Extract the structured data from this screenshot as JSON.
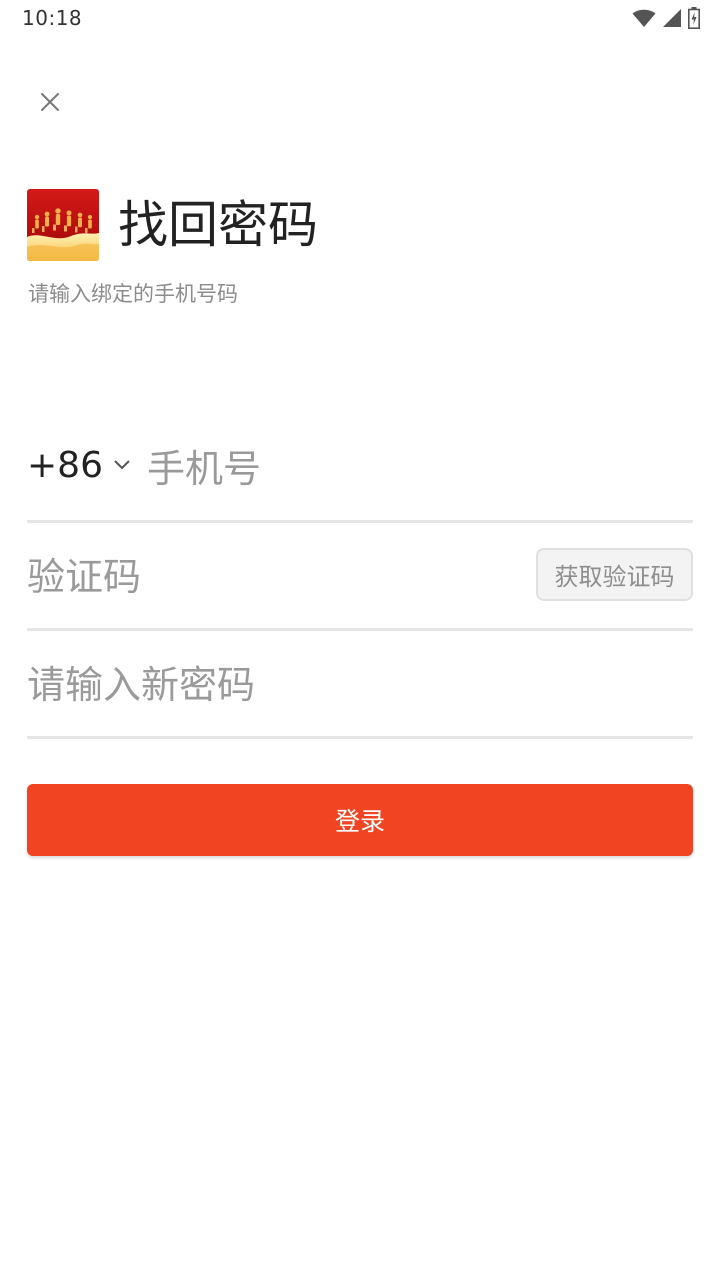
{
  "status_bar": {
    "time": "10:18",
    "icons": [
      "wifi-icon",
      "cellular-signal-icon",
      "battery-charging-icon"
    ]
  },
  "header": {
    "close_icon": "close-icon",
    "title": "找回密码",
    "subtitle": "请输入绑定的手机号码"
  },
  "form": {
    "country_code": "+86",
    "phone_placeholder": "手机号",
    "code_placeholder": "验证码",
    "get_code_label": "获取验证码",
    "password_placeholder": "请输入新密码",
    "submit_label": "登录"
  },
  "colors": {
    "accent": "#f04423",
    "divider": "#e6e6e6",
    "placeholder": "#9a9a9a"
  }
}
